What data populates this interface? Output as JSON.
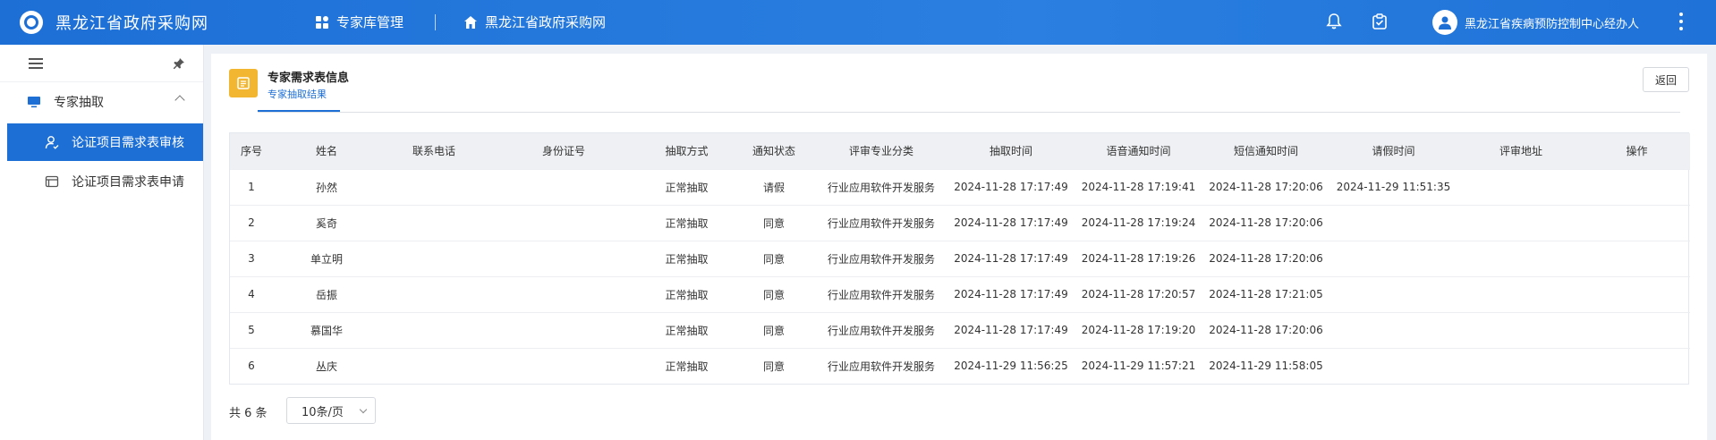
{
  "header": {
    "brand": "黑龙江省政府采购网",
    "nav_expert": "专家库管理",
    "nav_home": "黑龙江省政府采购网",
    "user_name": "黑龙江省疾病预防控制中心经办人"
  },
  "sidebar": {
    "group_label": "专家抽取",
    "items": [
      {
        "label": "论证项目需求表审核",
        "active": true
      },
      {
        "label": "论证项目需求表申请",
        "active": false
      }
    ]
  },
  "main": {
    "title": "专家需求表信息",
    "tab": "专家抽取结果",
    "back_label": "返回"
  },
  "table": {
    "headers": [
      "序号",
      "姓名",
      "联系电话",
      "身份证号",
      "抽取方式",
      "通知状态",
      "评审专业分类",
      "抽取时间",
      "语音通知时间",
      "短信通知时间",
      "请假时间",
      "评审地址",
      "操作"
    ],
    "rows": [
      {
        "no": "1",
        "name": "孙然",
        "phone": "",
        "id": "",
        "method": "正常抽取",
        "status": "请假",
        "category": "行业应用软件开发服务",
        "draw_time": "2024-11-28 17:17:49",
        "voice_time": "2024-11-28 17:19:41",
        "sms_time": "2024-11-28 17:20:06",
        "leave_time": "2024-11-29 11:51:35",
        "address": "",
        "action": ""
      },
      {
        "no": "2",
        "name": "奚奇",
        "phone": "",
        "id": "",
        "method": "正常抽取",
        "status": "同意",
        "category": "行业应用软件开发服务",
        "draw_time": "2024-11-28 17:17:49",
        "voice_time": "2024-11-28 17:19:24",
        "sms_time": "2024-11-28 17:20:06",
        "leave_time": "",
        "address": "",
        "action": ""
      },
      {
        "no": "3",
        "name": "单立明",
        "phone": "",
        "id": "",
        "method": "正常抽取",
        "status": "同意",
        "category": "行业应用软件开发服务",
        "draw_time": "2024-11-28 17:17:49",
        "voice_time": "2024-11-28 17:19:26",
        "sms_time": "2024-11-28 17:20:06",
        "leave_time": "",
        "address": "",
        "action": ""
      },
      {
        "no": "4",
        "name": "岳振",
        "phone": "",
        "id": "",
        "method": "正常抽取",
        "status": "同意",
        "category": "行业应用软件开发服务",
        "draw_time": "2024-11-28 17:17:49",
        "voice_time": "2024-11-28 17:20:57",
        "sms_time": "2024-11-28 17:21:05",
        "leave_time": "",
        "address": "",
        "action": ""
      },
      {
        "no": "5",
        "name": "慕国华",
        "phone": "",
        "id": "",
        "method": "正常抽取",
        "status": "同意",
        "category": "行业应用软件开发服务",
        "draw_time": "2024-11-28 17:17:49",
        "voice_time": "2024-11-28 17:19:20",
        "sms_time": "2024-11-28 17:20:06",
        "leave_time": "",
        "address": "",
        "action": ""
      },
      {
        "no": "6",
        "name": "丛庆",
        "phone": "",
        "id": "",
        "method": "正常抽取",
        "status": "同意",
        "category": "行业应用软件开发服务",
        "draw_time": "2024-11-29 11:56:25",
        "voice_time": "2024-11-29 11:57:21",
        "sms_time": "2024-11-29 11:58:05",
        "leave_time": "",
        "address": "",
        "action": ""
      }
    ]
  },
  "pagination": {
    "total_label": "共 6 条",
    "page_size": "10条/页"
  },
  "colors": {
    "primary": "#1d6fd6",
    "info_icon": "#f2b630"
  }
}
